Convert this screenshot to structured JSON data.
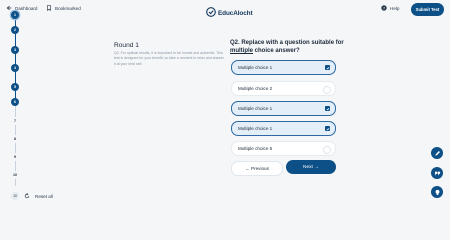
{
  "header": {
    "dashboard_label": "Dashboard",
    "bookmarked_label": "Bookmarked",
    "logo_text": "EducAlocht",
    "help_label": "Help",
    "submit_label": "Submit Test"
  },
  "progress": {
    "steps": [
      "1",
      "2",
      "3",
      "4",
      "5",
      "6",
      "7",
      "8",
      "9",
      "10"
    ],
    "completed_count": 5,
    "reset_label": "Reset all",
    "reset_badge": "10"
  },
  "round": {
    "title": "Round 1",
    "description": "Q2. For optimal results, it is important to be honest and authentic. This test is designed for your benefit, so take a moment to relax and answer it at your best self."
  },
  "question": {
    "prefix": "Q2. Replace with a question suitable for ",
    "underlined": "multiple",
    "suffix": " choice answer?"
  },
  "options": [
    {
      "label": "Multiple choice 1",
      "selected": true
    },
    {
      "label": "Multiple choice 2",
      "selected": false
    },
    {
      "label": "Multiple choice 1",
      "selected": true
    },
    {
      "label": "Multiple choice 1",
      "selected": true
    },
    {
      "label": "Multiple choice 5",
      "selected": false
    }
  ],
  "nav": {
    "previous_label": "← Previous",
    "next_label": "Next →"
  },
  "colors": {
    "primary": "#0d4f87",
    "selected_bg": "#e3eef8",
    "background": "#f4f6f8"
  },
  "fabs": [
    "pencil-icon",
    "quote-icon",
    "lightbulb-icon"
  ]
}
